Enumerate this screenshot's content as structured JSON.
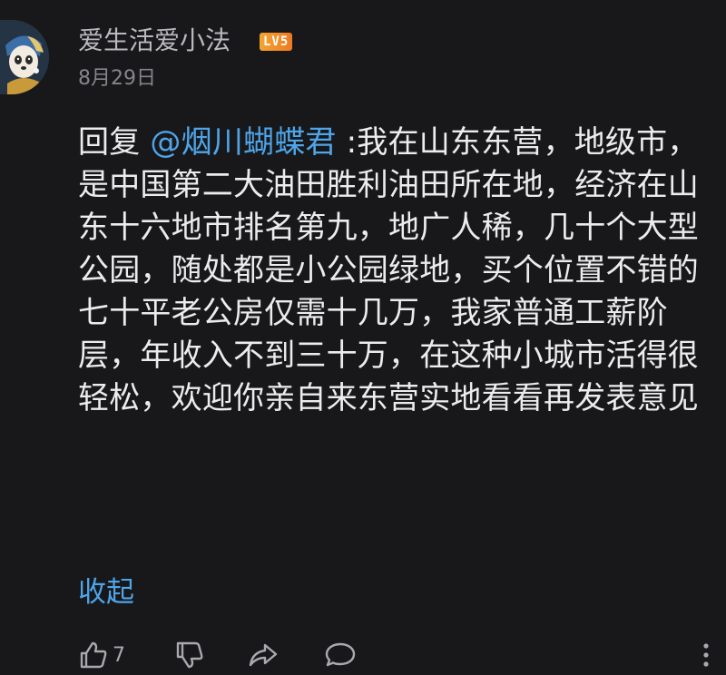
{
  "comment": {
    "author": "爱生活爱小法",
    "level_badge": "LV5",
    "date": "8月29日",
    "reply_prefix": "回复 ",
    "mention": "@烟川蝴蝶君",
    "content": " :我在山东东营，地级市，是中国第二大油田胜利油田所在地，经济在山东十六地市排名第九，地广人稀，几十个大型公园，随处都是小公园绿地，买个位置不错的七十平老公房仅需十几万，我家普通工薪阶层，年收入不到三十万，在这种小城市活得很轻松，欢迎你亲自来东营实地看看再发表意见",
    "collapse_label": "收起",
    "like_count": "7"
  },
  "icons": {
    "avatar": "avatar-image",
    "like": "thumbs-up-icon",
    "dislike": "thumbs-down-icon",
    "share": "share-icon",
    "reply": "comment-icon",
    "more": "more-vertical-icon"
  },
  "colors": {
    "background": "#18181a",
    "text": "#ececee",
    "secondary_text": "#85858a",
    "link": "#4ea5e9",
    "badge": "#ee7a24"
  }
}
